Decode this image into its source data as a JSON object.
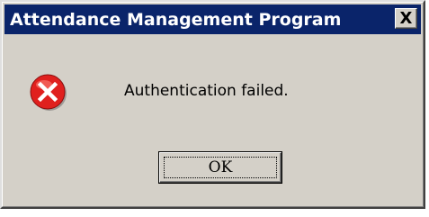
{
  "window": {
    "title": "Attendance Management Program",
    "close_label": "X"
  },
  "message": {
    "icon": "error-icon",
    "text": "Authentication failed."
  },
  "buttons": {
    "ok_label": "OK"
  },
  "colors": {
    "titlebar": "#0a246a",
    "dialog_face": "#d4d0c8",
    "error_red": "#e0201e"
  }
}
